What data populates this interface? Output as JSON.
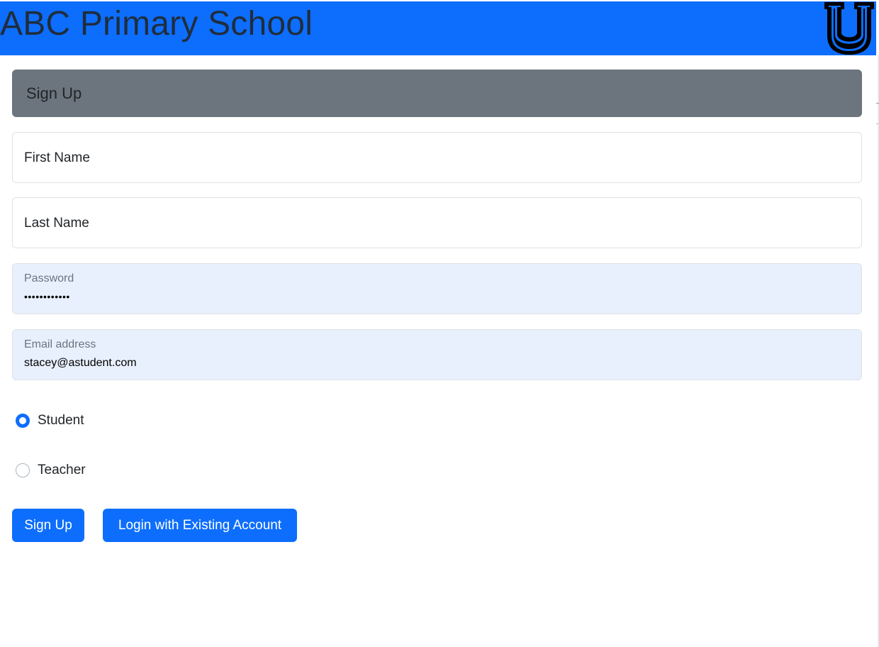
{
  "header": {
    "title": "ABC Primary School",
    "logo_icon": "university-u-logo-icon"
  },
  "form": {
    "heading": "Sign Up",
    "first_name": {
      "placeholder": "First Name",
      "value": ""
    },
    "last_name": {
      "placeholder": "Last Name",
      "value": ""
    },
    "password": {
      "label": "Password",
      "value": "••••••••••••"
    },
    "email": {
      "label": "Email address",
      "value": "stacey@astudent.com"
    },
    "roles": [
      {
        "label": "Student",
        "checked": true
      },
      {
        "label": "Teacher",
        "checked": false
      }
    ],
    "signup_button": "Sign Up",
    "login_button": "Login with Existing Account"
  },
  "colors": {
    "primary": "#0d6efd",
    "section_header": "#6c757d",
    "autofill_bg": "#e8f0fe"
  }
}
